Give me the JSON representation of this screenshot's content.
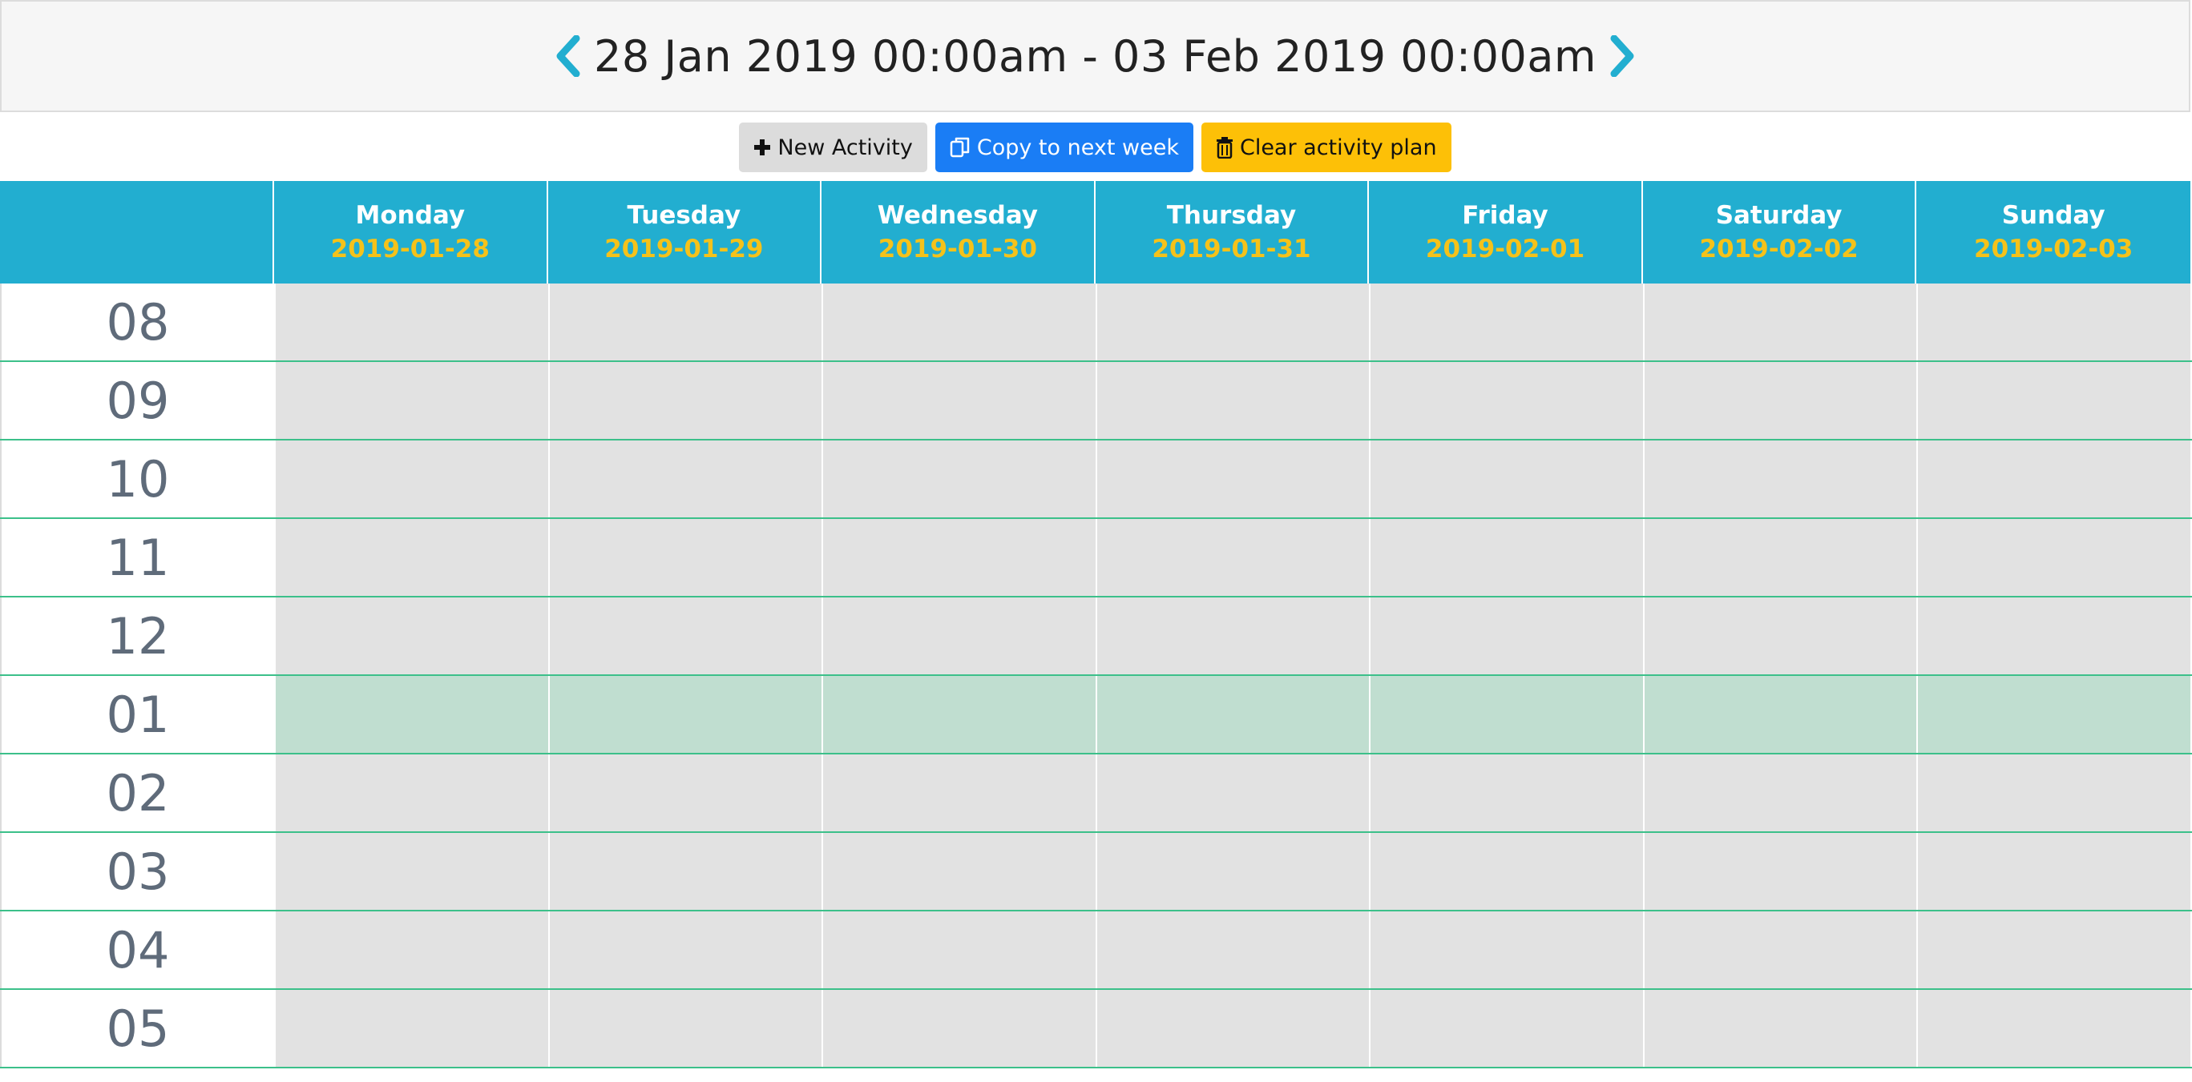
{
  "header": {
    "date_range": "28 Jan 2019 00:00am - 03 Feb 2019 00:00am",
    "prev_icon": "chevron-left-icon",
    "next_icon": "chevron-right-icon",
    "accent_color": "#22aed0"
  },
  "toolbar": {
    "new_activity_label": "New Activity",
    "copy_label": "Copy to next week",
    "clear_label": "Clear activity plan"
  },
  "calendar": {
    "days": [
      {
        "name": "Monday",
        "date": "2019-01-28"
      },
      {
        "name": "Tuesday",
        "date": "2019-01-29"
      },
      {
        "name": "Wednesday",
        "date": "2019-01-30"
      },
      {
        "name": "Thursday",
        "date": "2019-01-31"
      },
      {
        "name": "Friday",
        "date": "2019-02-01"
      },
      {
        "name": "Saturday",
        "date": "2019-02-02"
      },
      {
        "name": "Sunday",
        "date": "2019-02-03"
      }
    ],
    "hours": [
      "08",
      "09",
      "10",
      "11",
      "12",
      "01",
      "02",
      "03",
      "04",
      "05"
    ],
    "highlighted_hour": "01",
    "colors": {
      "header_bg": "#22aed0",
      "date_text": "#f5c21a",
      "slot_bg": "#e2e2e2",
      "highlight_bg": "#c0ded0",
      "row_line": "#3cc08a"
    }
  }
}
